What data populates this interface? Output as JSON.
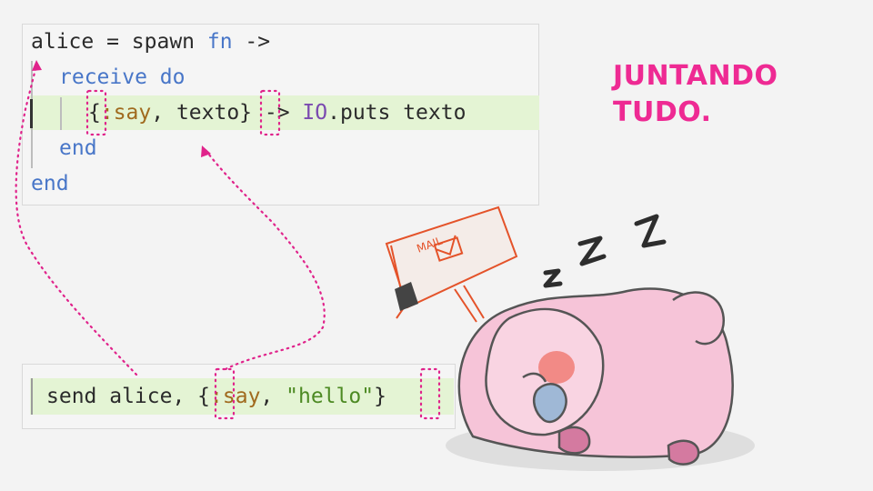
{
  "slide": {
    "title_line_1": "JUNTANDO",
    "title_line_2": "TUDO."
  },
  "code_top": {
    "line1": {
      "a": "alice = spawn ",
      "b": "fn",
      "c": " ->"
    },
    "line2": {
      "a": "receive",
      "b": " ",
      "c": "do"
    },
    "line3": {
      "a": "{",
      "b": ":say",
      "c": ", texto}",
      "d": " -> ",
      "e": "IO",
      "f": ".puts texto"
    },
    "line4": {
      "a": "end"
    },
    "line5": {
      "a": "end"
    }
  },
  "code_bottom": {
    "line1": {
      "a": "send alice, ",
      "b": "{",
      "c": ":say",
      "d": ", ",
      "e": "\"hello\"",
      "f": "}"
    }
  },
  "illustration": {
    "sign_text": "MAIL",
    "sleep_text": [
      "z",
      "Z",
      "Z"
    ]
  },
  "colors": {
    "accent": "#ee2a93",
    "keyword": "#4876c8",
    "atom": "#a06a1e",
    "string": "#4d8a23",
    "highlight": "#e4f4d4"
  }
}
